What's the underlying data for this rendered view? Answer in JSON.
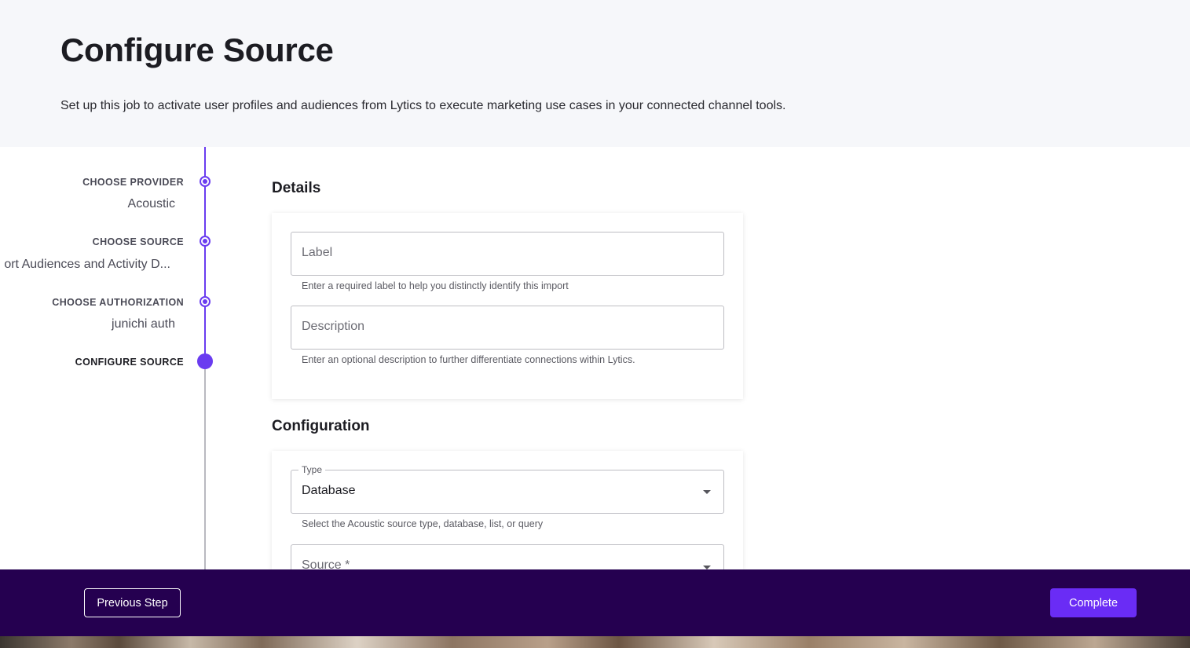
{
  "header": {
    "title": "Configure Source",
    "description": "Set up this job to activate user profiles and audiences from Lytics to execute marketing use cases in your connected channel tools."
  },
  "stepper": {
    "steps": [
      {
        "label": "CHOOSE PROVIDER",
        "value": "Acoustic",
        "state": "complete"
      },
      {
        "label": "CHOOSE SOURCE",
        "value": "ort Audiences and Activity D...",
        "state": "complete"
      },
      {
        "label": "CHOOSE AUTHORIZATION",
        "value": "junichi auth",
        "state": "complete"
      },
      {
        "label": "CONFIGURE SOURCE",
        "value": "",
        "state": "active"
      }
    ]
  },
  "details": {
    "title": "Details",
    "label_field": {
      "placeholder": "Label",
      "helper": "Enter a required label to help you distinctly identify this import"
    },
    "description_field": {
      "placeholder": "Description",
      "helper": "Enter an optional description to further differentiate connections within Lytics."
    }
  },
  "configuration": {
    "title": "Configuration",
    "type_field": {
      "legend": "Type",
      "value": "Database",
      "helper": "Select the Acoustic source type, database, list, or query"
    },
    "source_field": {
      "placeholder": "Source *"
    }
  },
  "footer": {
    "previous_label": "Previous Step",
    "complete_label": "Complete"
  },
  "colors": {
    "accent": "#6a3cf0",
    "footer_bg": "#250050",
    "complete_button": "#6a2cf5",
    "header_bg": "#f6f7fa"
  }
}
